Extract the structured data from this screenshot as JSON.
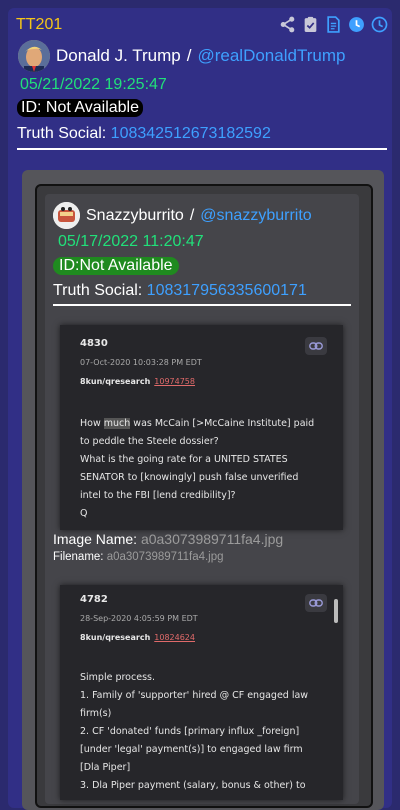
{
  "post": {
    "id": "TT201",
    "author_name": "Donald J. Trump",
    "separator": "/",
    "handle": "@realDonaldTrump",
    "timestamp": "05/21/2022 19:25:47",
    "id_label": "ID: Not Available",
    "truth_label": "Truth Social:",
    "truth_id": "108342512673182592"
  },
  "toolbar": {
    "icons": [
      "share-icon",
      "clipboard-check-icon",
      "document-icon",
      "clock-icon",
      "clock-outline-icon"
    ],
    "icon_color": "#3ea0ff"
  },
  "quoted": {
    "author_name": "Snazzyburrito",
    "separator": "/",
    "handle": "@snazzyburrito",
    "timestamp": "05/17/2022 11:20:47",
    "id_label": "ID:Not Available",
    "truth_label": "Truth Social:",
    "truth_id": "108317956335600171"
  },
  "qposts": [
    {
      "number": "4830",
      "date": "07-Oct-2020 10:03:28 PM EDT",
      "board": "8kun/qresearch",
      "link": "10974758",
      "body_pre": "How ",
      "body_hl": "much",
      "body_post": " was McCain [>McCaine Institute] paid\nto peddle the Steele dossier?\nWhat is the going rate for a UNITED STATES\nSENATOR to [knowingly] push false unverified\nintel to the FBI [lend credibility]?\nQ"
    },
    {
      "number": "4782",
      "date": "28-Sep-2020 4:05:59 PM EDT",
      "board": "8kun/qresearch",
      "link": "10824624",
      "body": "Simple process.\n1. Family of 'supporter' hired @ CF engaged law\nfirm(s)\n2. CF 'donated' funds [primary influx _foreign]\n[under 'legal' payment(s)] to engaged law firm\n[Dla Piper]\n3. Dla Piper payment (salary, bonus & other) to"
    }
  ],
  "image": {
    "name_label": "Image Name:",
    "name_value": "a0a3073989711fa4.jpg",
    "file_label": "Filename:",
    "file_value": "a0a3073989711fa4.jpg"
  },
  "colors": {
    "background": "#2b2a6e",
    "card": "#312f86",
    "accent_yellow": "#f5c518",
    "link_blue": "#3ea0ff",
    "time_green": "#21e07a",
    "id_pill_green": "#1f8a1f"
  }
}
